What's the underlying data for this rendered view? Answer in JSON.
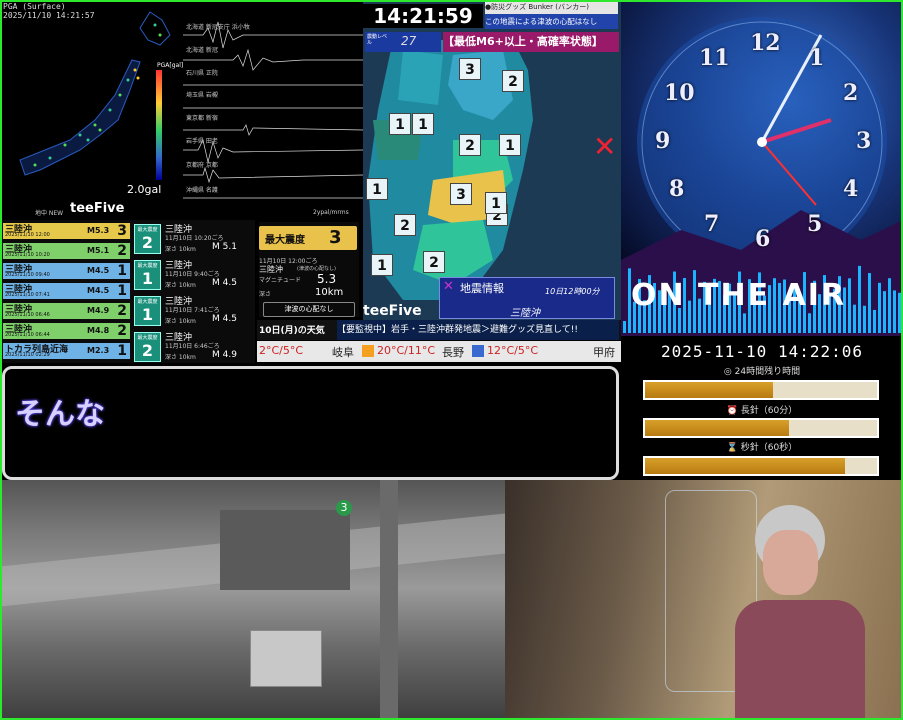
{
  "seismic": {
    "header_title": "PGA (Surface)",
    "header_time": "2025/11/10 14:21:57",
    "gal_value": "2.0gal",
    "scale_label": "PGA[gal]",
    "scale_ticks": [
      "1000",
      "500",
      "200",
      "100",
      "50",
      "20",
      "10",
      "5",
      "2",
      "1",
      "0.5",
      "0.2",
      "0.1",
      "0.05",
      "0.02",
      "0.01"
    ],
    "logo": "teeFive",
    "map_label": "地中 NEW",
    "stations": [
      "北海道 新冠支庁 浜小牧",
      "北海道 新冠",
      "石川県 正院",
      "埼玉県 岩槻",
      "東京都 新宿",
      "岩手県 田老",
      "京都府 京都",
      "沖縄県 名護"
    ],
    "waveform_unit": "2ypal/mrms"
  },
  "eq_list": [
    {
      "place": "三陸沖",
      "date": "2025/11/10 12:00",
      "mag": "M5.3",
      "int": "3",
      "color": "#e6c84a"
    },
    {
      "place": "三陸沖",
      "date": "2025/11/10 10:20",
      "mag": "M5.1",
      "int": "2",
      "color": "#7fd06a"
    },
    {
      "place": "三陸沖",
      "date": "2025/11/10 09:40",
      "mag": "M4.5",
      "int": "1",
      "color": "#6fb2e6"
    },
    {
      "place": "三陸沖",
      "date": "2025/11/10 07:41",
      "mag": "M4.5",
      "int": "1",
      "color": "#6fb2e6"
    },
    {
      "place": "三陸沖",
      "date": "2025/11/10 06:46",
      "mag": "M4.9",
      "int": "2",
      "color": "#7fd06a"
    },
    {
      "place": "三陸沖",
      "date": "2025/11/10 06:44",
      "mag": "M4.8",
      "int": "2",
      "color": "#7fd06a"
    },
    {
      "place": "トカラ列島近海",
      "date": "2025/11/10 02:29",
      "mag": "M2.3",
      "int": "1",
      "color": "#6fb2e6"
    }
  ],
  "eq_cards": [
    {
      "label": "最大震度",
      "int": "2",
      "place": "三陸沖",
      "time": "11月10日 10:20ごろ",
      "depth": "深さ 10km",
      "mag": "M 5.1"
    },
    {
      "label": "最大震度",
      "int": "1",
      "place": "三陸沖",
      "time": "11月10日 9:40ごろ",
      "depth": "深さ 10km",
      "mag": "M 4.5"
    },
    {
      "label": "最大震度",
      "int": "1",
      "place": "三陸沖",
      "time": "11月10日 7:41ごろ",
      "depth": "深さ 10km",
      "mag": "M 4.5"
    },
    {
      "label": "最大震度",
      "int": "2",
      "place": "三陸沖",
      "time": "11月10日 6:46ごろ",
      "depth": "深さ 10km",
      "mag": "M 4.9"
    }
  ],
  "max_box": {
    "label": "最大震度",
    "int": "3",
    "time": "11月10日 12:00ごろ",
    "place": "三陸沖",
    "sub": "(津波の心配なし)",
    "mag_label": "マグニチュード",
    "mag": "5.3",
    "depth_label": "深さ",
    "depth": "10km",
    "tsunami": "津波の心配なし"
  },
  "center": {
    "clock": "14:21:59",
    "banner": "【最低M6+以上・高確率状態】",
    "level_label": "震動レベル",
    "level": "27",
    "ticker_top": "●防災グッズ Bunker (バンカー)",
    "ticker_sub": "この地震による津波の心配はなし",
    "eq_info_title": "地震情報",
    "eq_info_time": "10日12時00分",
    "eq_info_place": "三陸沖",
    "logo": "teeFive",
    "map_marks": [
      "3",
      "2",
      "1",
      "1",
      "2",
      "1",
      "1",
      "3",
      "2",
      "2",
      "1",
      "2",
      "1"
    ]
  },
  "ticker": {
    "weather_day": "10日(月)の天気",
    "news": "【要監視中】岩手・三陸沖群発地震＞避難グッズ見直して!!"
  },
  "weather": [
    {
      "temp": "2°C/5°C",
      "city": "岐阜"
    },
    {
      "temp": "20°C/11°C",
      "city": "長野"
    },
    {
      "temp": "12°C/5°C",
      "city": "甲府"
    }
  ],
  "subtitle": {
    "text": "そんな"
  },
  "clock_panel": {
    "on_air": "ON THE AIR",
    "datetime": "2025-11-10 14:22:06",
    "timers": [
      {
        "label": "◎ 24時間残り時間",
        "fill": 0.55
      },
      {
        "label": "⏰ 長針（60分）",
        "fill": 0.62
      },
      {
        "label": "⌛ 秒針（60秒）",
        "fill": 0.86
      }
    ],
    "numbers": [
      "12",
      "1",
      "2",
      "3",
      "4",
      "5",
      "6",
      "7",
      "8",
      "9",
      "10",
      "11"
    ]
  },
  "camera_marker": "3"
}
